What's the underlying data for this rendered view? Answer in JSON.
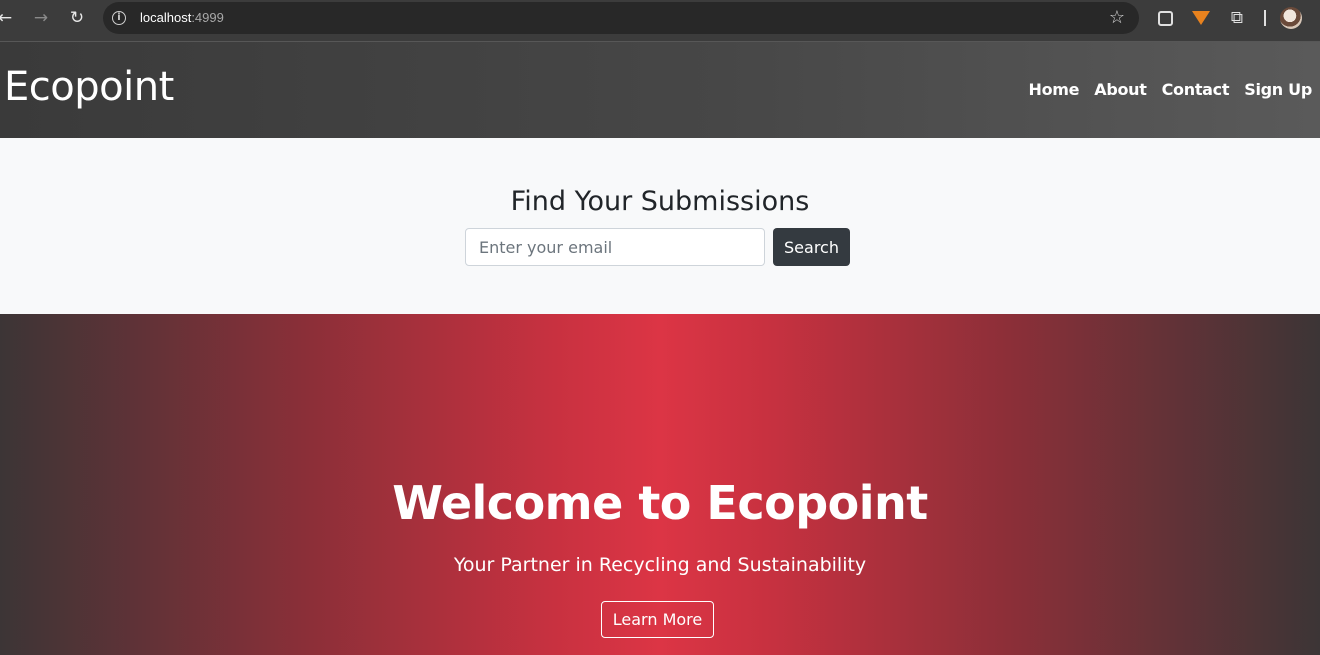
{
  "browser": {
    "url_host": "localhost",
    "url_port": ":4999",
    "back_icon": "←",
    "forward_icon": "→",
    "reload_icon": "↻",
    "star_icon": "☆",
    "puzzle_icon": "⧉"
  },
  "header": {
    "brand": "Ecopoint",
    "nav": [
      "Home",
      "About",
      "Contact",
      "Sign Up"
    ]
  },
  "search": {
    "title": "Find Your Submissions",
    "placeholder": "Enter your email",
    "button": "Search"
  },
  "hero": {
    "title": "Welcome to Ecopoint",
    "subtitle": "Your Partner in Recycling and Sustainability",
    "button": "Learn More"
  },
  "colors": {
    "accent": "#dc3545",
    "dark_button": "#343a40",
    "light_bg": "#f8f9fa"
  }
}
